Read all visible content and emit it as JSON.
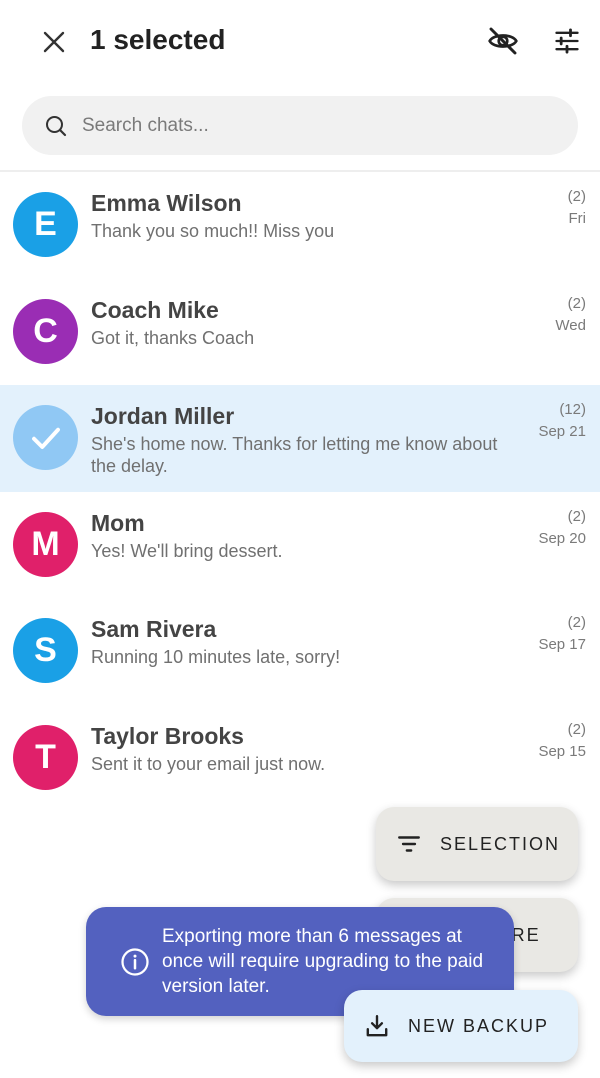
{
  "header": {
    "title": "1 selected",
    "icons": {
      "close": "close-icon",
      "visibility": "visibility-off-icon",
      "filters": "tune-icon"
    }
  },
  "search": {
    "placeholder": "Search chats..."
  },
  "chats": [
    {
      "initial": "E",
      "name": "Emma Wilson",
      "preview": "Thank you so much!! Miss you",
      "count": "(2)",
      "date": "Fri",
      "color": "#1aa0e6",
      "selected": false
    },
    {
      "initial": "C",
      "name": "Coach Mike",
      "preview": "Got it, thanks Coach",
      "count": "(2)",
      "date": "Wed",
      "color": "#9a2db4",
      "selected": false
    },
    {
      "initial": "",
      "name": "Jordan Miller",
      "preview": "She's home now. Thanks for letting me know about the delay.",
      "count": "(12)",
      "date": "Sep 21",
      "color": "#90c8f4",
      "selected": true
    },
    {
      "initial": "M",
      "name": "Mom",
      "preview": "Yes! We'll bring dessert.",
      "count": "(2)",
      "date": "Sep 20",
      "color": "#e0206a",
      "selected": false
    },
    {
      "initial": "S",
      "name": "Sam Rivera",
      "preview": "Running 10 minutes late, sorry!",
      "count": "(2)",
      "date": "Sep 17",
      "color": "#1aa0e6",
      "selected": false
    },
    {
      "initial": "T",
      "name": "Taylor Brooks",
      "preview": "Sent it to your email just now.",
      "count": "(2)",
      "date": "Sep 15",
      "color": "#e0206a",
      "selected": false
    }
  ],
  "fabs": {
    "selection": "SELECTION",
    "restore": "RESTORE",
    "new_backup": "NEW BACKUP"
  },
  "snackbar": {
    "message": "Exporting more than 6 messages at once will require upgrading to the paid version later."
  }
}
